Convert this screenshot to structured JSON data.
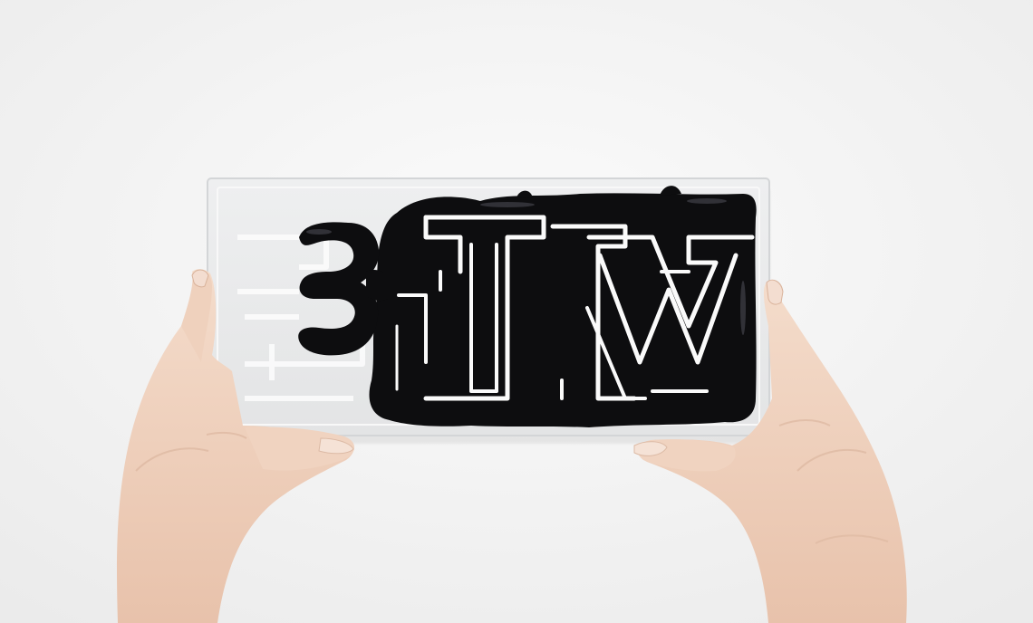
{
  "scene": {
    "description_label": "",
    "colors": {
      "background": "#f4f4f4",
      "panel": "#e9eaeb",
      "panel_edge": "#d7d9db",
      "ink": "#0d0d0f",
      "channel": "#fafafa",
      "skin": "#f1d6c4",
      "skin_shadow": "#d9b39b",
      "nail": "#f3ddd0"
    },
    "glyphs": {
      "letter_1": "",
      "letter_2": "",
      "letter_3": ""
    },
    "icons": [
      "hand-left",
      "hand-right",
      "acrylic-panel",
      "black-liquid-maze"
    ]
  }
}
